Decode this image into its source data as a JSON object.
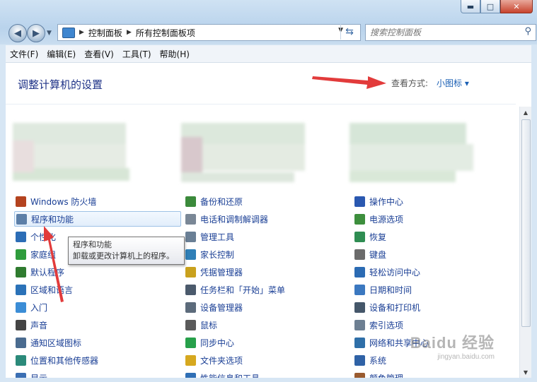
{
  "window": {
    "caption": {
      "minimize": "▬",
      "maximize": "□",
      "close": "✕"
    }
  },
  "nav": {
    "breadcrumbs": [
      "控制面板",
      "所有控制面板项"
    ],
    "search_placeholder": "搜索控制面板"
  },
  "menu": [
    "文件(F)",
    "编辑(E)",
    "查看(V)",
    "工具(T)",
    "帮助(H)"
  ],
  "header": {
    "title": "调整计算机的设置",
    "view_by_label": "查看方式:",
    "view_by_value": "小图标 ▾"
  },
  "items": {
    "col1": [
      "Windows 防火墙",
      "程序和功能",
      "个性化",
      "家庭组",
      "默认程序",
      "区域和语言",
      "入门",
      "声音",
      "通知区域图标",
      "位置和其他传感器",
      "显示"
    ],
    "col2": [
      "备份和还原",
      "电话和调制解调器",
      "管理工具",
      "家长控制",
      "凭据管理器",
      "任务栏和「开始」菜单",
      "设备管理器",
      "鼠标",
      "同步中心",
      "文件夹选项",
      "性能信息和工具"
    ],
    "col3": [
      "操作中心",
      "电源选项",
      "恢复",
      "键盘",
      "轻松访问中心",
      "日期和时间",
      "设备和打印机",
      "索引选项",
      "网络和共享中心",
      "系统",
      "颜色管理"
    ]
  },
  "tooltip": {
    "title": "程序和功能",
    "desc": "卸载或更改计算机上的程序。"
  },
  "watermark": {
    "main": "Baidu 经验",
    "sub": "jingyan.baidu.com"
  },
  "colors": {
    "link": "#1a3f95",
    "title": "#1e3287",
    "arrow": "#e23b3b"
  }
}
